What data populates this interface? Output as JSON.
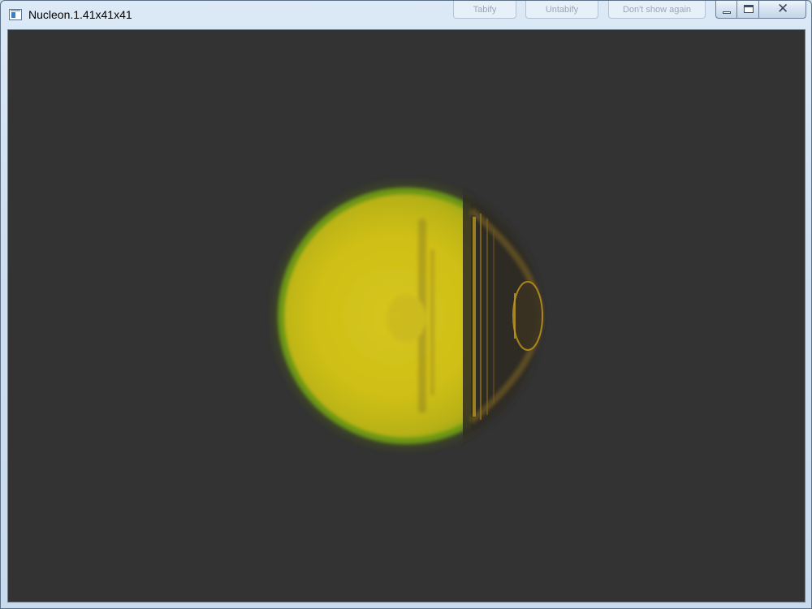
{
  "window": {
    "title": "Nucleon.1.41x41x41"
  },
  "background_buttons": [
    "Tabify",
    "Untabify",
    "Don't show again"
  ],
  "controls": {
    "minimize": "minimize",
    "maximize": "maximize",
    "close": "close"
  },
  "colors": {
    "canvas_background": "#333333",
    "sphere_core": "#d2c418",
    "sphere_rim": "#6f9a14",
    "structure": "#a88a20"
  }
}
